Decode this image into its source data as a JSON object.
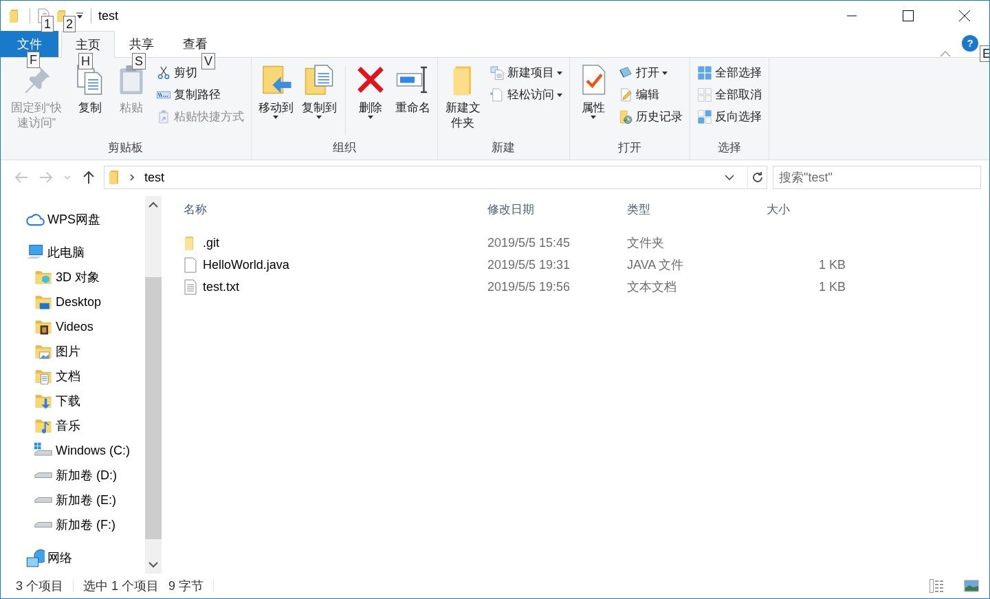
{
  "window": {
    "title": "test"
  },
  "ribbon": {
    "tabs": [
      {
        "label": "文件",
        "kind": "file",
        "selected": false
      },
      {
        "label": "主页",
        "kind": "tab",
        "selected": true
      },
      {
        "label": "共享",
        "kind": "tab",
        "selected": false
      },
      {
        "label": "查看",
        "kind": "tab",
        "selected": false
      }
    ],
    "help_button": {
      "label": "?"
    },
    "groups": [
      {
        "label": "剪贴板",
        "items": [
          {
            "kind": "large",
            "label": "固定到“快速访问”",
            "disabled": true,
            "dropdown": false
          },
          {
            "kind": "large",
            "label": "复制",
            "disabled": false,
            "dropdown": false
          },
          {
            "kind": "large",
            "label": "粘贴",
            "disabled": true,
            "dropdown": false
          },
          {
            "kind": "stack",
            "buttons": [
              {
                "label": "剪切",
                "disabled": false,
                "dropdown": false
              },
              {
                "label": "复制路径",
                "disabled": false,
                "dropdown": false
              },
              {
                "label": "粘贴快捷方式",
                "disabled": true,
                "dropdown": false
              }
            ]
          }
        ]
      },
      {
        "label": "组织",
        "items": [
          {
            "kind": "large",
            "label": "移动到",
            "disabled": false,
            "dropdown": true
          },
          {
            "kind": "large",
            "label": "复制到",
            "disabled": false,
            "dropdown": true
          },
          {
            "kind": "separator"
          },
          {
            "kind": "large",
            "label": "删除",
            "disabled": false,
            "dropdown": true
          },
          {
            "kind": "large",
            "label": "重命名",
            "disabled": false,
            "dropdown": false
          }
        ]
      },
      {
        "label": "新建",
        "items": [
          {
            "kind": "large",
            "label": "新建文件夹",
            "disabled": false,
            "dropdown": false
          },
          {
            "kind": "stack",
            "buttons": [
              {
                "label": "新建项目",
                "disabled": false,
                "dropdown": true
              },
              {
                "label": "轻松访问",
                "disabled": false,
                "dropdown": true
              }
            ]
          }
        ]
      },
      {
        "label": "打开",
        "items": [
          {
            "kind": "large",
            "label": "属性",
            "disabled": false,
            "dropdown": true
          },
          {
            "kind": "stack",
            "buttons": [
              {
                "label": "打开",
                "disabled": false,
                "dropdown": true
              },
              {
                "label": "编辑",
                "disabled": false,
                "dropdown": false
              },
              {
                "label": "历史记录",
                "disabled": false,
                "dropdown": false
              }
            ]
          }
        ]
      },
      {
        "label": "选择",
        "items": [
          {
            "kind": "stack",
            "buttons": [
              {
                "label": "全部选择",
                "disabled": false,
                "dropdown": false
              },
              {
                "label": "全部取消",
                "disabled": false,
                "dropdown": false
              },
              {
                "label": "反向选择",
                "disabled": false,
                "dropdown": false
              }
            ]
          }
        ]
      }
    ]
  },
  "key_tips": [
    "1",
    "2",
    "F",
    "H",
    "S",
    "V",
    "E"
  ],
  "nav_buttons": [
    {
      "kind": "back",
      "disabled": true
    },
    {
      "kind": "forward",
      "disabled": true
    },
    {
      "kind": "recent",
      "disabled": true
    },
    {
      "kind": "up",
      "disabled": false
    }
  ],
  "address": {
    "crumbs": [
      "test"
    ]
  },
  "search": {
    "placeholder": "搜索\"test\""
  },
  "nav_pane": {
    "items": [
      {
        "label": "WPS网盘"
      },
      {
        "label": "此电脑",
        "children": [
          {
            "label": "3D 对象"
          },
          {
            "label": "Desktop"
          },
          {
            "label": "Videos"
          },
          {
            "label": "图片"
          },
          {
            "label": "文档"
          },
          {
            "label": "下载"
          },
          {
            "label": "音乐"
          },
          {
            "label": "Windows (C:)"
          },
          {
            "label": "新加卷 (D:)"
          },
          {
            "label": "新加卷 (E:)"
          },
          {
            "label": "新加卷 (F:)"
          }
        ]
      },
      {
        "label": "网络"
      }
    ]
  },
  "file_list": {
    "columns": [
      "名称",
      "修改日期",
      "类型",
      "大小"
    ],
    "rows": [
      {
        "kind": "folder",
        "name": ".git",
        "modified": "2019/5/5 15:45",
        "type": "文件夹"
      },
      {
        "kind": "file",
        "name": "HelloWorld.java",
        "modified": "2019/5/5 19:31",
        "type": "JAVA 文件",
        "size": "1 KB"
      },
      {
        "kind": "text",
        "name": "test.txt",
        "modified": "2019/5/5 19:56",
        "type": "文本文档",
        "size": "1 KB"
      }
    ]
  },
  "status_bar": {
    "items": [
      "3 个项目",
      "选中 1 个项目",
      "9 字节"
    ]
  }
}
